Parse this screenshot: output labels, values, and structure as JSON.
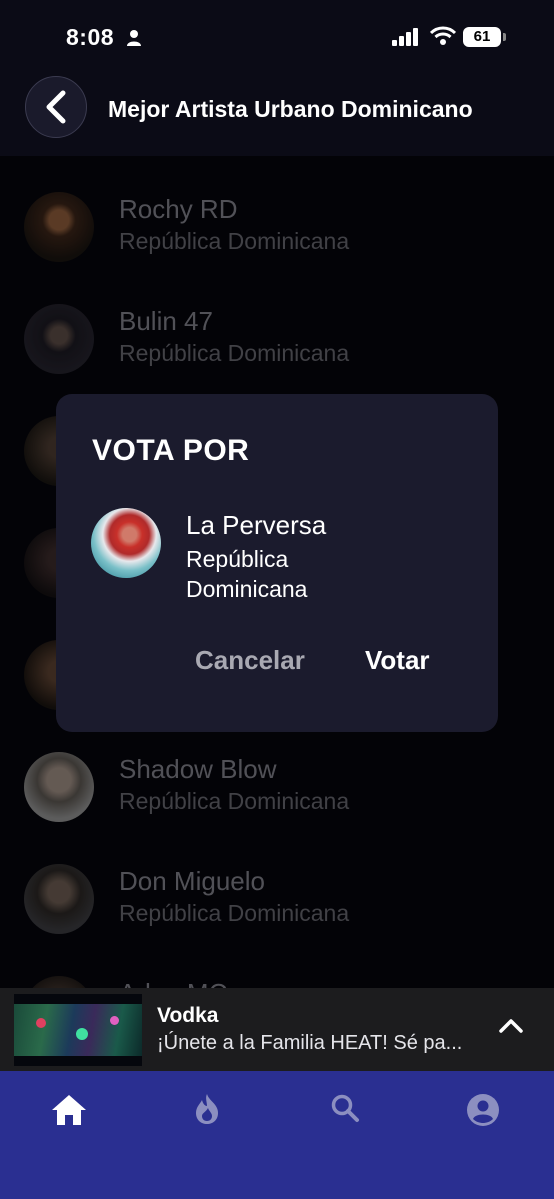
{
  "status_bar": {
    "time": "8:08",
    "battery": "61"
  },
  "header": {
    "title": "Mejor Artista Urbano Dominicano"
  },
  "artists": [
    {
      "name": "Rochy RD",
      "country": "República Dominicana"
    },
    {
      "name": "Bulin 47",
      "country": "República Dominicana"
    },
    {
      "name": "",
      "country": ""
    },
    {
      "name": "",
      "country": ""
    },
    {
      "name": "",
      "country": ""
    },
    {
      "name": "Shadow Blow",
      "country": "República Dominicana"
    },
    {
      "name": "Don Miguelo",
      "country": "República Dominicana"
    },
    {
      "name": "Adr... MC",
      "country": ""
    }
  ],
  "dialog": {
    "title": "VOTA POR",
    "artist_name": "La Perversa",
    "artist_country": "República Dominicana",
    "cancel_label": "Cancelar",
    "vote_label": "Votar"
  },
  "now_playing": {
    "title": "Vodka",
    "subtitle": "¡Únete a la Familia HEAT! Sé pa..."
  },
  "tab_bar": {
    "tabs": [
      {
        "icon": "home-icon",
        "active": true
      },
      {
        "icon": "fire-icon",
        "active": false
      },
      {
        "icon": "search-icon",
        "active": false
      },
      {
        "icon": "account-icon",
        "active": false
      }
    ]
  },
  "colors": {
    "background": "#05050b",
    "dialog": "#1b1b2d",
    "tab_bar": "#2a2f91",
    "now_playing": "#1c1c1e"
  }
}
